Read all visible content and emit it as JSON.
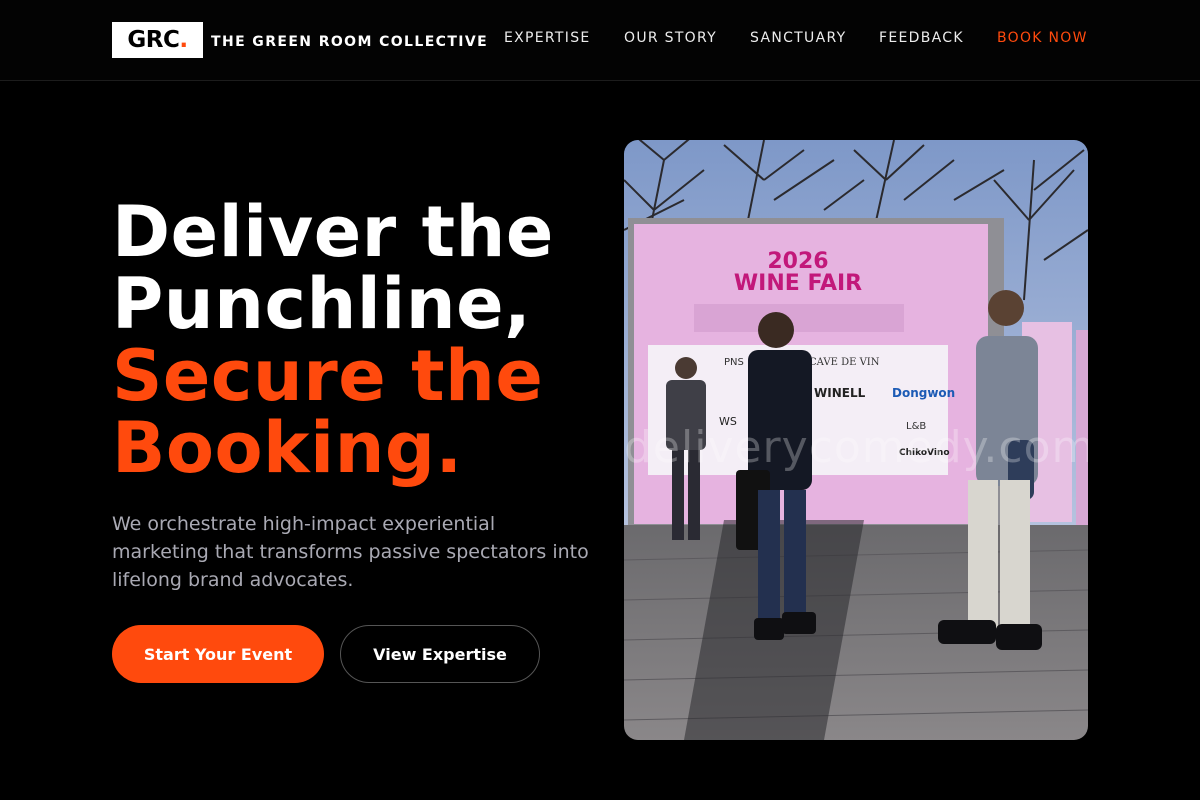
{
  "header": {
    "logo": {
      "text": "GRC",
      "dot": "."
    },
    "brand_name": "THE GREEN ROOM COLLECTIVE",
    "nav": [
      {
        "label": "EXPERTISE"
      },
      {
        "label": "OUR STORY"
      },
      {
        "label": "SANCTUARY"
      },
      {
        "label": "FEEDBACK"
      },
      {
        "label": "BOOK NOW"
      }
    ]
  },
  "hero": {
    "headline_white": [
      "Deliver the",
      "Punchline,"
    ],
    "headline_orange": [
      "Secure the",
      "Booking."
    ],
    "subcopy": "We orchestrate high-impact experiential marketing that transforms passive spectators into lifelong brand advocates.",
    "primary_button": "Start Your Event",
    "secondary_button": "View Expertise"
  },
  "image": {
    "banner_year": "2026",
    "banner_title": "WINE FAIR",
    "watermark": "deliverycomedy.com",
    "sponsors": [
      "PNS",
      "CAVE DE VIN",
      "WINELL",
      "Dongwon",
      "WS",
      "L&B",
      "ChikoVino"
    ]
  },
  "colors": {
    "accent": "#ff4a0d",
    "background": "#000000",
    "subcopy": "#a9a9b3"
  }
}
